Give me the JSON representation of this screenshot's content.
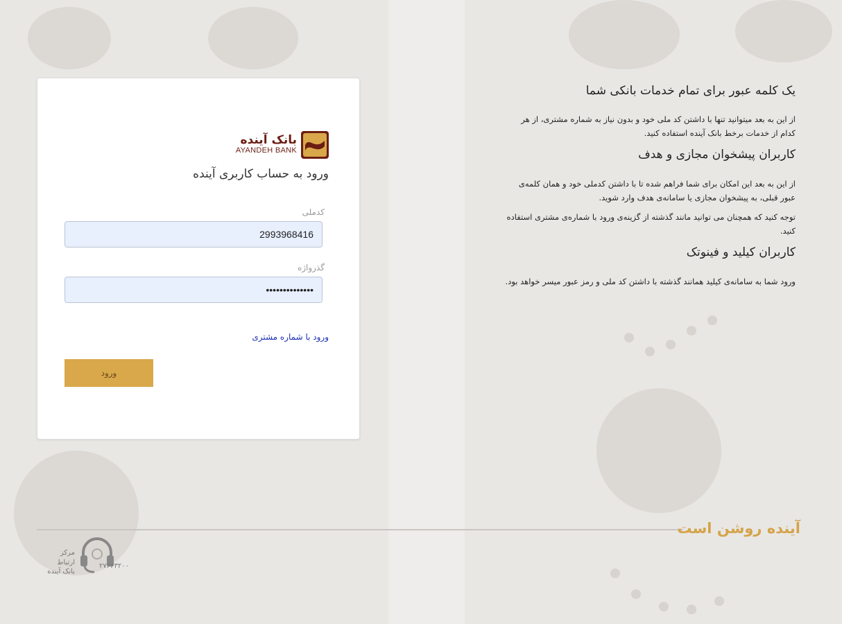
{
  "login": {
    "logo_fa": "بانک آینده",
    "logo_en": "AYANDEH BANK",
    "title": "ورود به حساب کاربری آینده",
    "national_code_label": "کدملی",
    "national_code_value": "2993968416",
    "password_label": "گذرواژه",
    "password_value": "••••••••••••••",
    "customer_number_link": "ورود با شماره مشتری",
    "submit_label": "ورود"
  },
  "info": {
    "heading1": "یک کلمه عبور برای تمام خدمات بانکی شما",
    "paragraph1": "از این به بعد میتوانید تنها با داشتن کد ملی خود و بدون نیاز به شماره مشتری، از هر کدام از خدمات برخط بانک آینده استفاده کنید.",
    "heading2": "کاربران پیشخوان مجازی و هدف",
    "paragraph2a": "از این به بعد این امکان برای شما فراهم شده تا با داشتن کدملی خود و همان کلمه‌ی عبور قبلی، به پیشخوان مجازی یا سامانه‌ی هدف وارد شوید.",
    "paragraph2b": "توجه کنید که همچنان می توانید مانند گذشته از گزینه‌ی ورود با شماره‌ی مشتری استفاده کنید.",
    "heading3": "کاربران کیلید و فینوتک",
    "paragraph3": "ورود شما به سامانه‌ی کیلید همانند گذشته با داشتن کد ملی و رمز عبور میسر خواهد بود."
  },
  "footer": {
    "slogan": "آینده روشن است",
    "support_title": "مرکز ارتباط",
    "support_bank": "بانک آینده",
    "support_phone": "۲۷۶۶۳۲۰۰"
  },
  "colors": {
    "brand_maroon": "#6b1e12",
    "brand_gold": "#d9a84a",
    "link_blue": "#1a2fb3",
    "input_bg": "#e8f0fe"
  },
  "icons": [
    "bank-logo-icon",
    "headset-icon"
  ]
}
